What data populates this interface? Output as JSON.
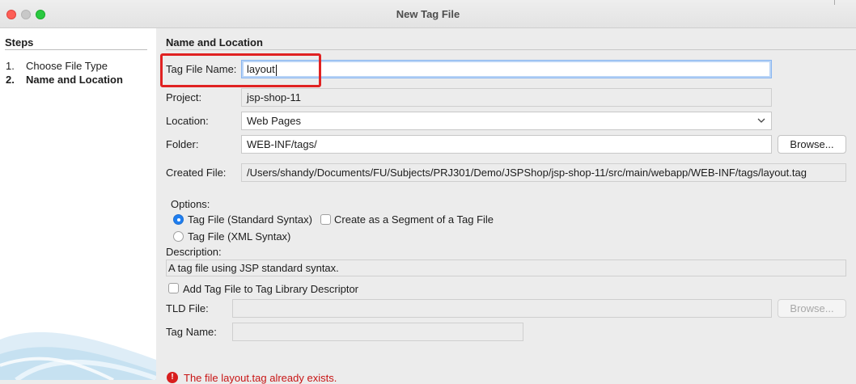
{
  "window": {
    "title": "New Tag File"
  },
  "steps": {
    "title": "Steps",
    "items": [
      {
        "num": "1.",
        "label": "Choose File Type"
      },
      {
        "num": "2.",
        "label": "Name and Location"
      }
    ]
  },
  "panel": {
    "title": "Name and Location"
  },
  "form": {
    "tag_file_name": {
      "label": "Tag File Name:",
      "value": "layout"
    },
    "project": {
      "label": "Project:",
      "value": "jsp-shop-11"
    },
    "location": {
      "label": "Location:",
      "value": "Web Pages",
      "icon": "chevron-down-icon"
    },
    "folder": {
      "label": "Folder:",
      "value": "WEB-INF/tags/",
      "browse": "Browse..."
    },
    "created_file": {
      "label": "Created File:",
      "value": "/Users/shandy/Documents/FU/Subjects/PRJ301/Demo/JSPShop/jsp-shop-11/src/main/webapp/WEB-INF/tags/layout.tag"
    }
  },
  "options": {
    "label": "Options:",
    "standard_syntax": {
      "label": "Tag File (Standard Syntax)",
      "selected": true
    },
    "segment": {
      "label": "Create as a Segment of a Tag File",
      "checked": false
    },
    "xml_syntax": {
      "label": "Tag File (XML Syntax)",
      "selected": false
    }
  },
  "description": {
    "label": "Description:",
    "value": "A tag file using JSP standard syntax."
  },
  "tld": {
    "add_label": "Add Tag File to Tag Library Descriptor",
    "add_checked": false,
    "tld_file_label": "TLD File:",
    "tld_file_value": "",
    "browse": "Browse...",
    "tag_name_label": "Tag Name:",
    "tag_name_value": ""
  },
  "error": {
    "icon": "error-icon",
    "text": "The file layout.tag already exists."
  },
  "colors": {
    "highlight": "#e02222",
    "error": "#c81414",
    "accent": "#1f7ef0"
  }
}
